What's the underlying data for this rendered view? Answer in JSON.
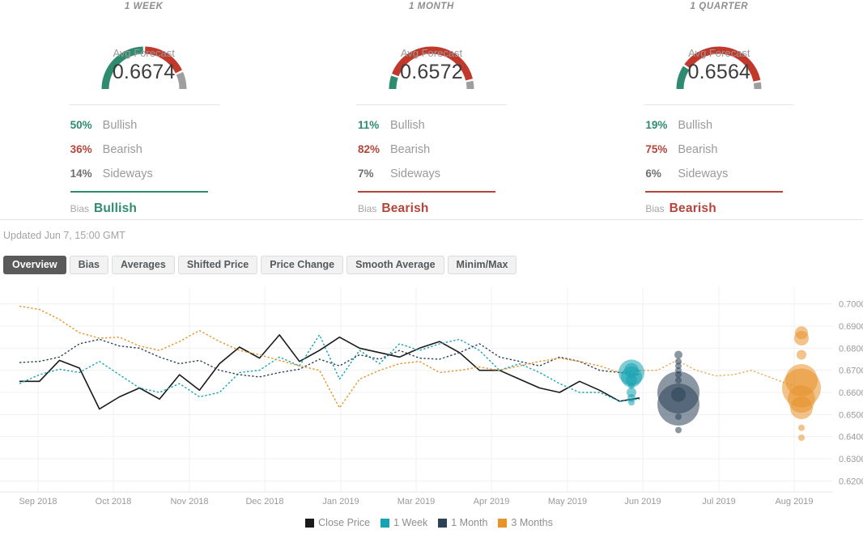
{
  "forecast_panels": [
    {
      "title": "1 WEEK",
      "gauge_label": "Avg Forecast",
      "gauge_value": "0.6674",
      "bullish_pct": "50%",
      "bullish_label": "Bullish",
      "bearish_pct": "36%",
      "bearish_label": "Bearish",
      "sideways_pct": "14%",
      "sideways_label": "Sideways",
      "bias_label": "Bias",
      "bias_value": "Bullish",
      "bias_color": "#2e8b6f",
      "gauge_green": 50,
      "gauge_red": 36,
      "gauge_gray": 14
    },
    {
      "title": "1 MONTH",
      "gauge_label": "Avg Forecast",
      "gauge_value": "0.6572",
      "bullish_pct": "11%",
      "bullish_label": "Bullish",
      "bearish_pct": "82%",
      "bearish_label": "Bearish",
      "sideways_pct": "7%",
      "sideways_label": "Sideways",
      "bias_label": "Bias",
      "bias_value": "Bearish",
      "bias_color": "#b5453a",
      "gauge_green": 11,
      "gauge_red": 82,
      "gauge_gray": 7
    },
    {
      "title": "1 QUARTER",
      "gauge_label": "Avg Forecast",
      "gauge_value": "0.6564",
      "bullish_pct": "19%",
      "bullish_label": "Bullish",
      "bearish_pct": "75%",
      "bearish_label": "Bearish",
      "sideways_pct": "6%",
      "sideways_label": "Sideways",
      "bias_label": "Bias",
      "bias_value": "Bearish",
      "bias_color": "#b5453a",
      "gauge_green": 19,
      "gauge_red": 75,
      "gauge_gray": 6
    }
  ],
  "updated_text": "Updated Jun 7, 15:00 GMT",
  "tabs": [
    {
      "label": "Overview",
      "active": true
    },
    {
      "label": "Bias",
      "active": false
    },
    {
      "label": "Averages",
      "active": false
    },
    {
      "label": "Shifted Price",
      "active": false
    },
    {
      "label": "Price Change",
      "active": false
    },
    {
      "label": "Smooth Average",
      "active": false
    },
    {
      "label": "Minim/Max",
      "active": false
    }
  ],
  "colors": {
    "bullish": "#2e8b6f",
    "bearish": "#b5453a",
    "sideways": "#6f6f6f",
    "gauge_green": "#2e8b6f",
    "gauge_red": "#c0392b",
    "gauge_gray": "#9e9e9e",
    "close_price": "#1a1a1a",
    "one_week": "#16a3b3",
    "one_month": "#2c4257",
    "three_months": "#e8922a",
    "gridline": "#f0f0f4",
    "axis_text": "#9a9a9a"
  },
  "chart_data": {
    "type": "line",
    "title": "",
    "xlabel": "",
    "ylabel": "",
    "ylim": [
      0.615,
      0.705
    ],
    "yticks": [
      "0.7000",
      "0.6900",
      "0.6800",
      "0.6700",
      "0.6600",
      "0.6500",
      "0.6400",
      "0.6300",
      "0.6200"
    ],
    "ytick_values": [
      0.7,
      0.69,
      0.68,
      0.67,
      0.66,
      0.65,
      0.64,
      0.63,
      0.62
    ],
    "xticks": [
      "Sep 2018",
      "Oct 2018",
      "Nov 2018",
      "Dec 2018",
      "Jan 2019",
      "Mar 2019",
      "Apr 2019",
      "May 2019",
      "Jun 2019",
      "Jul 2019",
      "Aug 2019"
    ],
    "grid": true,
    "legend_position": "bottom",
    "legend": [
      {
        "name": "Close Price",
        "color": "#1a1a1a",
        "style": "solid"
      },
      {
        "name": "1 Week",
        "color": "#16a3b3",
        "style": "dotted"
      },
      {
        "name": "1 Month",
        "color": "#2c4257",
        "style": "dotted"
      },
      {
        "name": "3 Months",
        "color": "#e8922a",
        "style": "dotted"
      }
    ],
    "series": [
      {
        "name": "Close Price",
        "color": "#1a1a1a",
        "style": "solid",
        "values": [
          0.665,
          0.665,
          0.6745,
          0.671,
          0.6525,
          0.658,
          0.662,
          0.657,
          0.668,
          0.661,
          0.673,
          0.6805,
          0.6755,
          0.686,
          0.674,
          0.679,
          0.685,
          0.68,
          0.678,
          0.676,
          0.68,
          0.683,
          0.678,
          0.67,
          0.67,
          0.666,
          0.662,
          0.66,
          0.665,
          0.661,
          0.656,
          0.6575
        ]
      },
      {
        "name": "1 Week",
        "color": "#16a3b3",
        "style": "dotted",
        "values": [
          0.664,
          0.668,
          0.6705,
          0.669,
          0.674,
          0.668,
          0.662,
          0.66,
          0.664,
          0.658,
          0.66,
          0.669,
          0.67,
          0.676,
          0.672,
          0.686,
          0.666,
          0.679,
          0.673,
          0.682,
          0.679,
          0.682,
          0.684,
          0.679,
          0.67,
          0.673,
          0.669,
          0.664,
          0.66,
          0.66,
          0.656,
          0.657
        ]
      },
      {
        "name": "1 Month",
        "color": "#2c4257",
        "style": "dotted",
        "values": [
          0.6735,
          0.674,
          0.676,
          0.682,
          0.684,
          0.681,
          0.68,
          0.676,
          0.673,
          0.6745,
          0.67,
          0.668,
          0.667,
          0.669,
          0.6705,
          0.675,
          0.672,
          0.677,
          0.675,
          0.679,
          0.6755,
          0.675,
          0.678,
          0.682,
          0.676,
          0.674,
          0.672,
          0.676,
          0.674,
          0.67,
          0.669,
          0.668
        ]
      },
      {
        "name": "3 Months",
        "color": "#e8922a",
        "style": "dotted",
        "values": [
          0.699,
          0.6975,
          0.693,
          0.687,
          0.6845,
          0.685,
          0.681,
          0.679,
          0.683,
          0.688,
          0.683,
          0.679,
          0.677,
          0.6745,
          0.672,
          0.67,
          0.653,
          0.666,
          0.67,
          0.673,
          0.674,
          0.669,
          0.67,
          0.6715,
          0.67,
          0.672,
          0.674,
          0.6755,
          0.674,
          0.672,
          0.669,
          0.67
        ]
      }
    ],
    "forecast_clusters": [
      {
        "name": "1 Week",
        "color": "#16a3b3",
        "x_label": "Jun 2019",
        "bubbles": [
          {
            "value": 0.67,
            "size": 9
          },
          {
            "value": 0.669,
            "size": 16
          },
          {
            "value": 0.667,
            "size": 13
          },
          {
            "value": 0.6655,
            "size": 7
          },
          {
            "value": 0.663,
            "size": 4
          },
          {
            "value": 0.66,
            "size": 6
          },
          {
            "value": 0.6575,
            "size": 5
          },
          {
            "value": 0.6555,
            "size": 4
          }
        ]
      },
      {
        "name": "1 Month",
        "color": "#2c4257",
        "x_label": "Jun 2019",
        "bubbles": [
          {
            "value": 0.677,
            "size": 5
          },
          {
            "value": 0.674,
            "size": 4
          },
          {
            "value": 0.672,
            "size": 4
          },
          {
            "value": 0.67,
            "size": 4
          },
          {
            "value": 0.668,
            "size": 4
          },
          {
            "value": 0.6655,
            "size": 4
          },
          {
            "value": 0.66,
            "size": 26
          },
          {
            "value": 0.6545,
            "size": 26
          },
          {
            "value": 0.659,
            "size": 9
          },
          {
            "value": 0.649,
            "size": 4
          },
          {
            "value": 0.643,
            "size": 4
          }
        ]
      },
      {
        "name": "3 Months",
        "color": "#e8922a",
        "x_label": "Aug 2019",
        "bubbles": [
          {
            "value": 0.687,
            "size": 8
          },
          {
            "value": 0.6845,
            "size": 9
          },
          {
            "value": 0.677,
            "size": 6
          },
          {
            "value": 0.6655,
            "size": 20
          },
          {
            "value": 0.662,
            "size": 24
          },
          {
            "value": 0.657,
            "size": 17
          },
          {
            "value": 0.653,
            "size": 14
          },
          {
            "value": 0.644,
            "size": 4
          },
          {
            "value": 0.6395,
            "size": 4
          }
        ]
      }
    ]
  }
}
